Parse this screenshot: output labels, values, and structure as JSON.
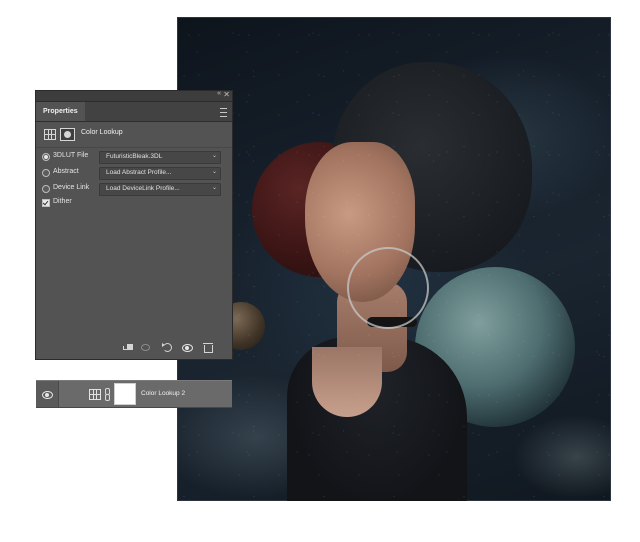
{
  "properties_panel": {
    "tab_label": "Properties",
    "title": "Color Lookup",
    "rows": [
      {
        "label": "3DLUT File",
        "value": "FuturisticBleak.3DL",
        "selected": true
      },
      {
        "label": "Abstract",
        "value": "Load Abstract Profile...",
        "selected": false
      },
      {
        "label": "Device Link",
        "value": "Load DeviceLink Profile...",
        "selected": false
      }
    ],
    "dither_label": "Dither",
    "dither_checked": true,
    "topbar": {
      "collapse_glyph": "«",
      "close_glyph": "✕"
    },
    "footer_icons": [
      "clip-to-layer-icon",
      "view-previous-state-icon",
      "reset-icon",
      "visibility-eye-icon",
      "trash-icon"
    ]
  },
  "layer": {
    "name": "Color Lookup 2",
    "visible": true
  },
  "colors": {
    "panel_bg": "#535353",
    "tab_bar": "#424242",
    "layer_row": "#6a6a6a",
    "canvas_bg": "#16202b"
  }
}
